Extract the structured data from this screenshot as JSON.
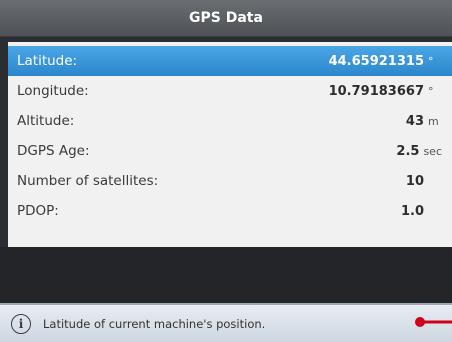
{
  "header": {
    "title": "GPS Data"
  },
  "rows": [
    {
      "label": "Latitude:",
      "value": "44.65921315",
      "unit": "°",
      "selected": true
    },
    {
      "label": "Longitude:",
      "value": "10.79183667",
      "unit": "°",
      "selected": false
    },
    {
      "label": "Altitude:",
      "value": "43",
      "unit": "m",
      "selected": false
    },
    {
      "label": "DGPS Age:",
      "value": "2.5",
      "unit": "sec",
      "selected": false
    },
    {
      "label": "Number of satellites:",
      "value": "10",
      "unit": "",
      "selected": false
    },
    {
      "label": "PDOP:",
      "value": "1.0",
      "unit": "",
      "selected": false
    }
  ],
  "status": {
    "icon": "info-icon",
    "icon_glyph": "i",
    "text": "Latitude of current machine's position."
  },
  "colors": {
    "selection": "#2b86cc",
    "pointer": "#d0021b"
  }
}
